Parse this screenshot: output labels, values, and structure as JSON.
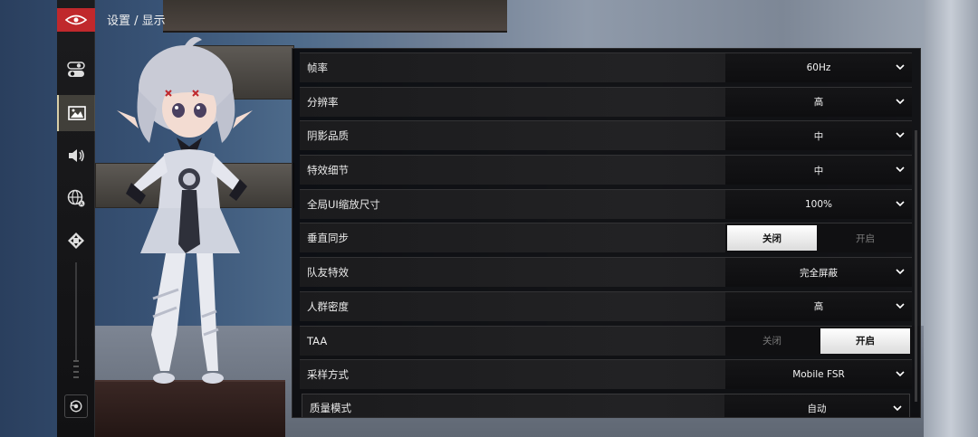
{
  "breadcrumb": "设置 / 显示",
  "sidebar": {
    "logo_icon": "game-logo-eye",
    "items": [
      {
        "icon": "toggle-switches-icon",
        "active": false
      },
      {
        "icon": "image-display-icon",
        "active": true
      },
      {
        "icon": "speaker-icon",
        "active": false
      },
      {
        "icon": "globe-language-icon",
        "active": false
      },
      {
        "icon": "dpad-controls-icon",
        "active": false
      }
    ],
    "reset_icon": "reset-camera-icon"
  },
  "settings": [
    {
      "label": "帧率",
      "type": "select",
      "value": "60Hz"
    },
    {
      "label": "分辨率",
      "type": "select",
      "value": "高"
    },
    {
      "label": "阴影品质",
      "type": "select",
      "value": "中"
    },
    {
      "label": "特效细节",
      "type": "select",
      "value": "中"
    },
    {
      "label": "全局UI缩放尺寸",
      "type": "select",
      "value": "100%"
    },
    {
      "label": "垂直同步",
      "type": "toggle",
      "off_label": "关闭",
      "on_label": "开启",
      "value": "关闭"
    },
    {
      "label": "队友特效",
      "type": "select",
      "value": "完全屏蔽"
    },
    {
      "label": "人群密度",
      "type": "select",
      "value": "高"
    },
    {
      "label": "TAA",
      "type": "toggle",
      "off_label": "关闭",
      "on_label": "开启",
      "value": "开启"
    },
    {
      "label": "采样方式",
      "type": "select",
      "value": "Mobile FSR"
    },
    {
      "label": "质量模式",
      "type": "select",
      "value": "自动",
      "sub": true
    }
  ],
  "colors": {
    "accent_red": "#c0282c",
    "toggle_on_bg": "#f2f2f2",
    "panel_bg": "#0c0c0e"
  }
}
